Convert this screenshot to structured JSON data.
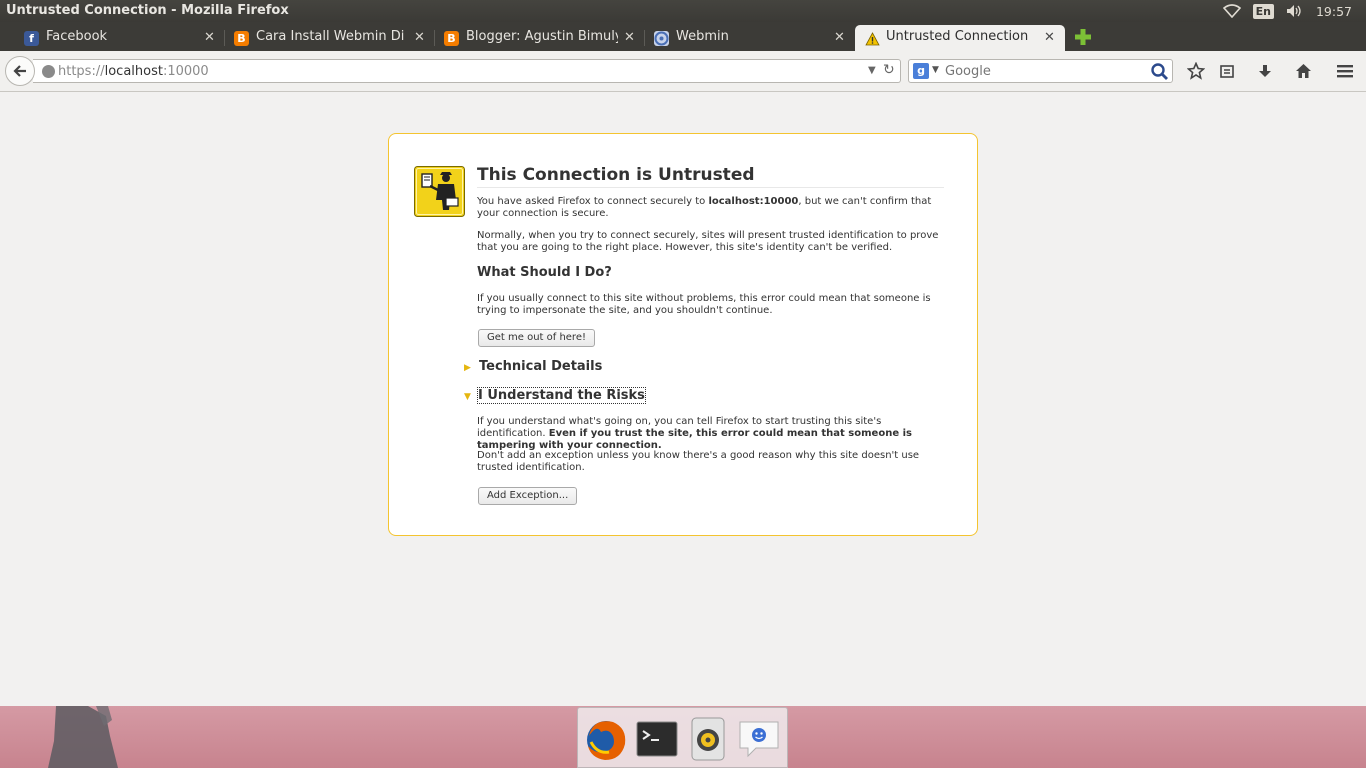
{
  "window": {
    "title": "Untrusted Connection - Mozilla Firefox"
  },
  "panel": {
    "lang": "En",
    "clock": "19:57"
  },
  "tabs": [
    {
      "label": "Facebook",
      "favicon": "facebook-icon",
      "color": "#3b5998"
    },
    {
      "label": "Cara Install Webmin Di ...",
      "favicon": "blogger-icon",
      "color": "#f57d00"
    },
    {
      "label": "Blogger: Agustin Bimuly…",
      "favicon": "blogger-icon",
      "color": "#f57d00"
    },
    {
      "label": "Webmin",
      "favicon": "webmin-icon",
      "color": "#4a6fb5"
    },
    {
      "label": "Untrusted Connection",
      "favicon": "warning-icon",
      "color": "#e0b400"
    }
  ],
  "nav": {
    "url_scheme": "https://",
    "url_host": "localhost",
    "url_port": ":10000",
    "search_engine": "Google",
    "search_placeholder": "Google"
  },
  "error": {
    "title": "This Connection is Untrusted",
    "p1_before": "You have asked Firefox to connect securely to ",
    "p1_host": "localhost:10000",
    "p1_after": ", but we can't confirm that your connection is secure.",
    "p2": "Normally, when you try to connect securely, sites will present trusted identification to prove that you are going to the right place. However, this site's identity can't be verified.",
    "what_heading": "What Should I Do?",
    "p3": "If you usually connect to this site without problems, this error could mean that someone is trying to impersonate the site, and you shouldn't continue.",
    "get_out_button": "Get me out of here!",
    "technical_heading": "Technical Details",
    "risks_heading": "I Understand the Risks",
    "p4_normal": "If you understand what's going on, you can tell Firefox to start trusting this site's identification. ",
    "p4_bold": "Even if you trust the site, this error could mean that someone is tampering with your connection.",
    "p5": "Don't add an exception unless you know there's a good reason why this site doesn't use trusted identification.",
    "add_exception_button": "Add Exception..."
  },
  "dock": [
    {
      "name": "firefox-icon"
    },
    {
      "name": "terminal-icon"
    },
    {
      "name": "rhythmbox-icon"
    },
    {
      "name": "empathy-icon"
    }
  ],
  "colors": {
    "accent_border": "#f4c430",
    "panel": "#3c3b37",
    "desktop": "#cd8e98"
  }
}
